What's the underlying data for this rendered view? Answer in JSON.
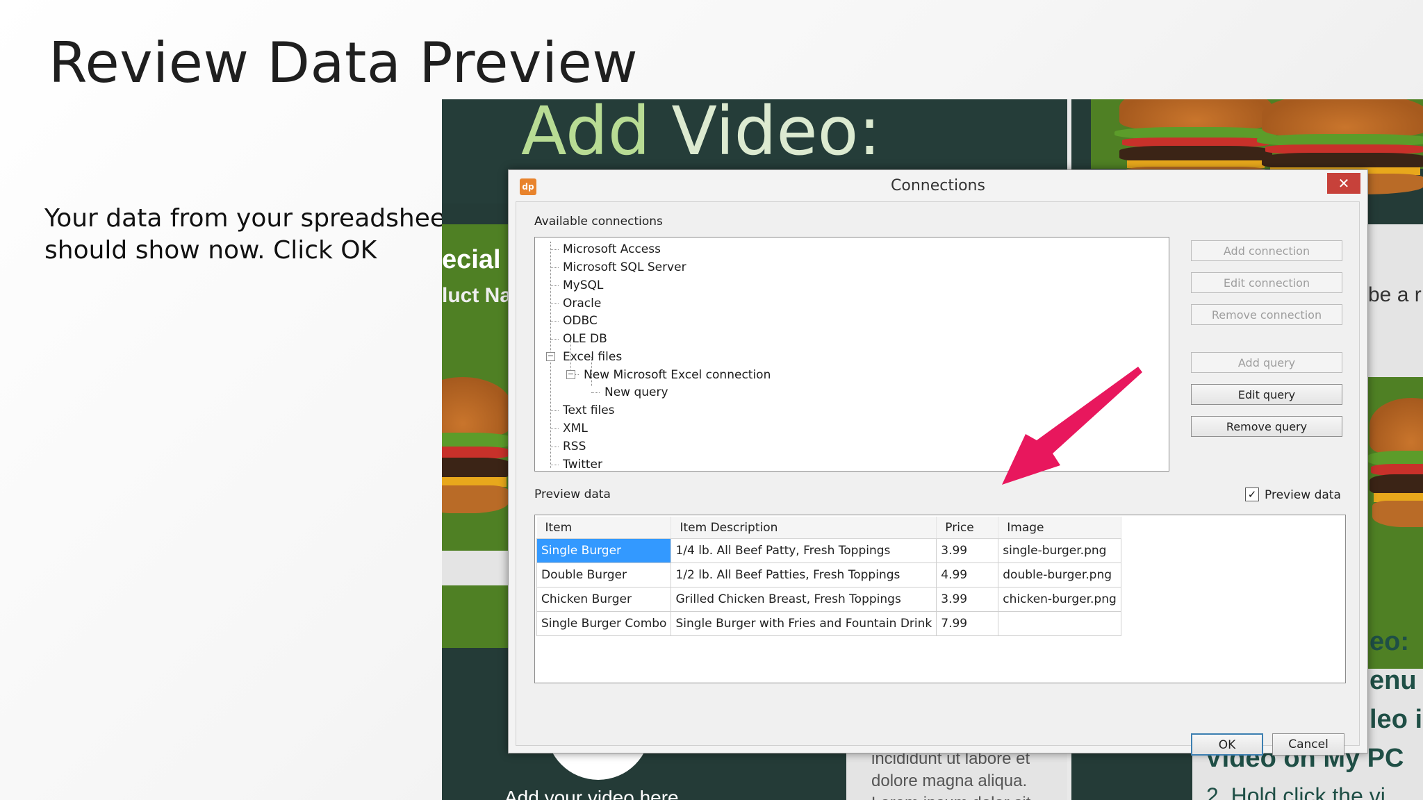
{
  "slide": {
    "title": "Review Data Preview",
    "body_line1": "Your data from your spreadsheet",
    "body_line2": "should show now. Click OK"
  },
  "background": {
    "add_video_part1": "Add",
    "add_video_part2": " Video:",
    "left_text1": "ecial c",
    "left_text2": "luct Na",
    "right_text1": "be a r",
    "right_text2": "eo:",
    "right_text3": "enu",
    "right_text4": "leo i",
    "right_text5": "Video on My PC",
    "right_text6": "2.   Hold click the vi",
    "lorem1": "incididunt ut labore et",
    "lorem2": "dolore magna aliqua.",
    "lorem3": "Lorem ipsum dolor sit",
    "left_bottom": "Add your video here"
  },
  "dialog": {
    "title": "Connections",
    "icon_text": "dp",
    "close_glyph": "✕",
    "available_label": "Available connections",
    "tree": [
      {
        "label": "Microsoft Access"
      },
      {
        "label": "Microsoft SQL Server"
      },
      {
        "label": "MySQL"
      },
      {
        "label": "Oracle"
      },
      {
        "label": "ODBC"
      },
      {
        "label": "OLE DB"
      },
      {
        "label": "Excel files"
      },
      {
        "label": "New Microsoft Excel connection"
      },
      {
        "label": "New query"
      },
      {
        "label": "Text files"
      },
      {
        "label": "XML"
      },
      {
        "label": "RSS"
      },
      {
        "label": "Twitter"
      }
    ],
    "buttons": {
      "add_connection": "Add connection",
      "edit_connection": "Edit connection",
      "remove_connection": "Remove connection",
      "add_query": "Add query",
      "edit_query": "Edit query",
      "remove_query": "Remove query",
      "ok": "OK",
      "cancel": "Cancel"
    },
    "preview_label": "Preview data",
    "preview_checkbox_label": "Preview data",
    "preview_checked": "✓",
    "table": {
      "headers": [
        "Item",
        "Item Description",
        "Price",
        "Image"
      ],
      "rows": [
        [
          "Single Burger",
          "1/4 lb. All Beef Patty, Fresh Toppings",
          "3.99",
          "single-burger.png"
        ],
        [
          "Double Burger",
          "1/2 lb. All Beef Patties, Fresh Toppings",
          "4.99",
          "double-burger.png"
        ],
        [
          "Chicken Burger",
          "Grilled Chicken Breast, Fresh Toppings",
          "3.99",
          "chicken-burger.png"
        ],
        [
          "Single Burger Combo",
          "Single Burger with Fries and Fountain Drink",
          "7.99",
          ""
        ]
      ]
    }
  },
  "colors": {
    "selection": "#3399ff",
    "close_button": "#c7413a",
    "arrow": "#e8175d",
    "bg_green": "#4f8024",
    "bg_dark": "#253d39"
  }
}
